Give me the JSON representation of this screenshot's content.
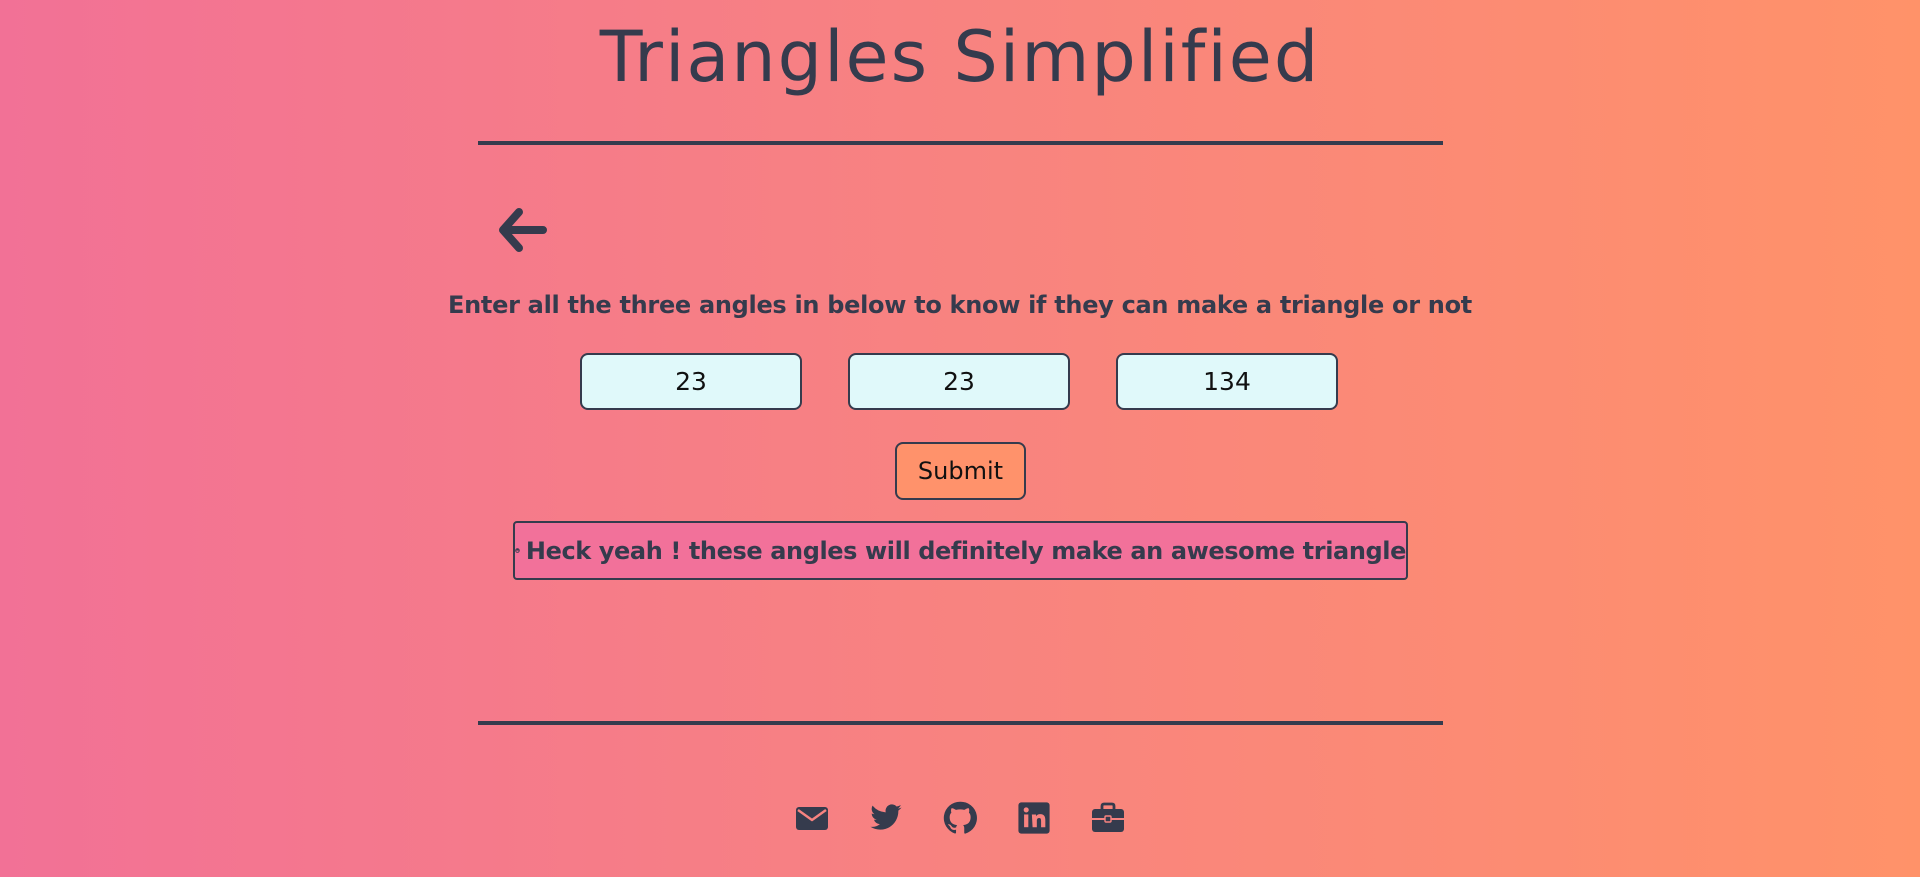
{
  "header": {
    "title": "Triangles Simplified"
  },
  "nav": {
    "back_icon": "arrow-left-icon"
  },
  "main": {
    "instructions": "Enter all the three angles in below to know if they can make a triangle or not",
    "angles": [
      "23",
      "23",
      "134"
    ],
    "submit_label": "Submit",
    "result": {
      "icon": "grinning-face-icon",
      "text": "Heck yeah ! these angles will definitely make an awesome triangle"
    }
  },
  "footer": {
    "icons": [
      "envelope-icon",
      "twitter-icon",
      "github-icon",
      "linkedin-icon",
      "briefcase-icon"
    ]
  },
  "colors": {
    "text": "#353b4d",
    "gradient_start": "#f27196",
    "gradient_end": "#ff9269",
    "input_bg": "#e0f9fa",
    "button_bg": "#ff926b",
    "result_bg": "#f2719a"
  }
}
